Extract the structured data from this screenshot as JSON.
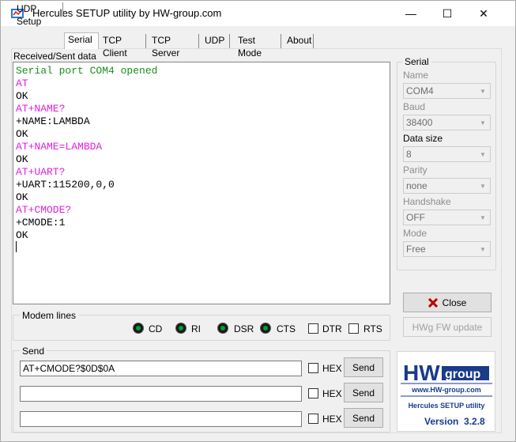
{
  "window": {
    "title": "Hercules SETUP utility by HW-group.com",
    "minimize_glyph": "—",
    "maximize_glyph": "☐",
    "close_glyph": "✕"
  },
  "tabs": [
    {
      "label": "UDP Setup",
      "active": false
    },
    {
      "label": "Serial",
      "active": true
    },
    {
      "label": "TCP Client",
      "active": false
    },
    {
      "label": "TCP Server",
      "active": false
    },
    {
      "label": "UDP",
      "active": false
    },
    {
      "label": "Test Mode",
      "active": false
    },
    {
      "label": "About",
      "active": false
    }
  ],
  "terminal": {
    "label": "Received/Sent data",
    "lines": [
      {
        "text": "Serial port COM4 opened",
        "color": "#1a8f1a"
      },
      {
        "text": "AT",
        "color": "#e020e0"
      },
      {
        "text": "OK",
        "color": "#000000"
      },
      {
        "text": "AT+NAME?",
        "color": "#e020e0"
      },
      {
        "text": "+NAME:LAMBDA",
        "color": "#000000"
      },
      {
        "text": "OK",
        "color": "#000000"
      },
      {
        "text": "AT+NAME=LAMBDA",
        "color": "#e020e0"
      },
      {
        "text": "OK",
        "color": "#000000"
      },
      {
        "text": "AT+UART?",
        "color": "#e020e0"
      },
      {
        "text": "+UART:115200,0,0",
        "color": "#000000"
      },
      {
        "text": "OK",
        "color": "#000000"
      },
      {
        "text": "AT+CMODE?",
        "color": "#e020e0"
      },
      {
        "text": "+CMODE:1",
        "color": "#000000"
      },
      {
        "text": "OK",
        "color": "#000000"
      }
    ]
  },
  "serial": {
    "group_label": "Serial",
    "name_label": "Name",
    "name_value": "COM4",
    "baud_label": "Baud",
    "baud_value": "38400",
    "datasize_label": "Data size",
    "datasize_value": "8",
    "parity_label": "Parity",
    "parity_value": "none",
    "handshake_label": "Handshake",
    "handshake_value": "OFF",
    "mode_label": "Mode",
    "mode_value": "Free"
  },
  "buttons": {
    "close_label": "Close",
    "hwg_update_label": "HWg FW update"
  },
  "modem_lines": {
    "label": "Modem lines",
    "cd": "CD",
    "ri": "RI",
    "dsr": "DSR",
    "cts": "CTS",
    "dtr": "DTR",
    "rts": "RTS"
  },
  "send": {
    "label": "Send",
    "rows": [
      {
        "value": "AT+CMODE?$0D$0A",
        "hex_label": "HEX",
        "button_label": "Send"
      },
      {
        "value": "",
        "hex_label": "HEX",
        "button_label": "Send"
      },
      {
        "value": "",
        "hex_label": "HEX",
        "button_label": "Send"
      }
    ]
  },
  "logo": {
    "brand_hw": "HW",
    "brand_group": "group",
    "site": "www.HW-group.com",
    "product": "Hercules SETUP utility",
    "version": "Version  3.2.8"
  },
  "colors": {
    "close_icon": "#c00000",
    "logo_blue": "#1a3a8a"
  }
}
